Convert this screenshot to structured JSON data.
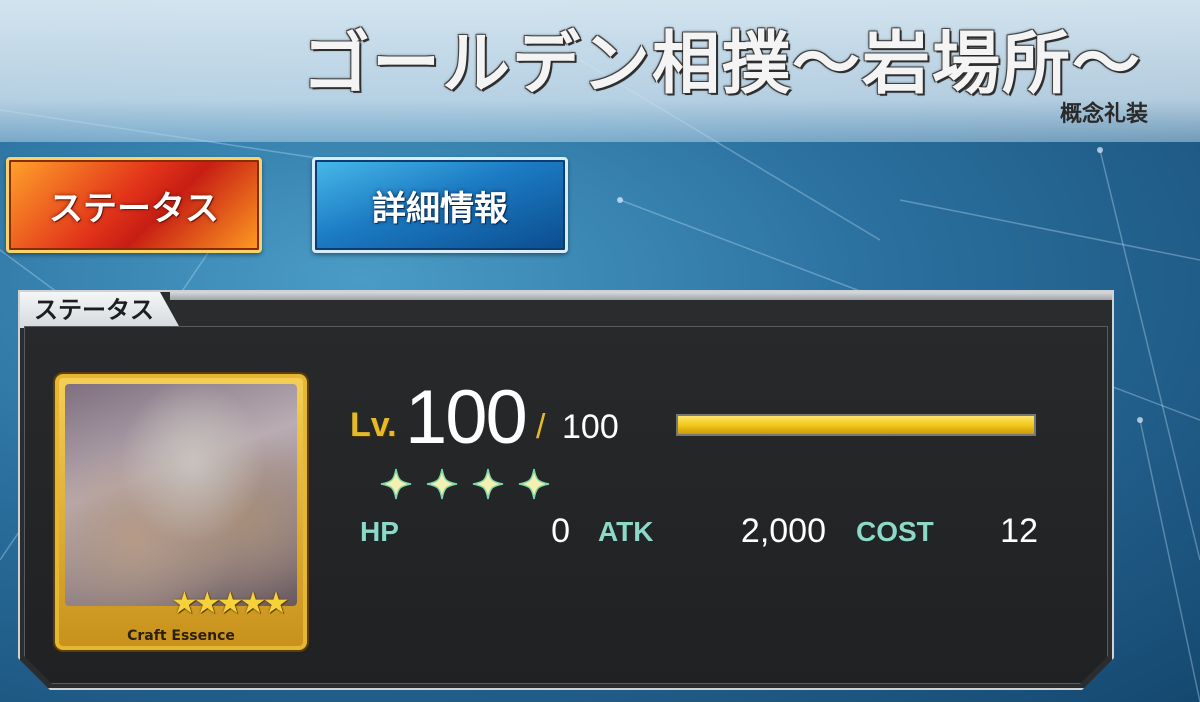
{
  "header": {
    "title": "ゴールデン相撲～岩場所～",
    "subtitle": "概念礼装"
  },
  "tabs": [
    {
      "label": "ステータス",
      "active": true
    },
    {
      "label": "詳細情報",
      "active": false
    }
  ],
  "panel": {
    "heading": "ステータス"
  },
  "card": {
    "caption": "Craft Essence",
    "rarity_stars": 5,
    "stars_text": "★★★★★"
  },
  "level": {
    "prefix": "Lv.",
    "current": "100",
    "separator": "/",
    "max": "100",
    "progress": 1.0
  },
  "rarity_sparkles": 4,
  "stats": {
    "hp_label": "HP",
    "hp_value": "0",
    "atk_label": "ATK",
    "atk_value": "2,000",
    "cost_label": "COST",
    "cost_value": "12"
  },
  "colors": {
    "accent_gold": "#e5b928",
    "stat_label": "#8fd7c8",
    "tab_active": "#e2331a",
    "tab_inactive": "#1c7bc3"
  }
}
